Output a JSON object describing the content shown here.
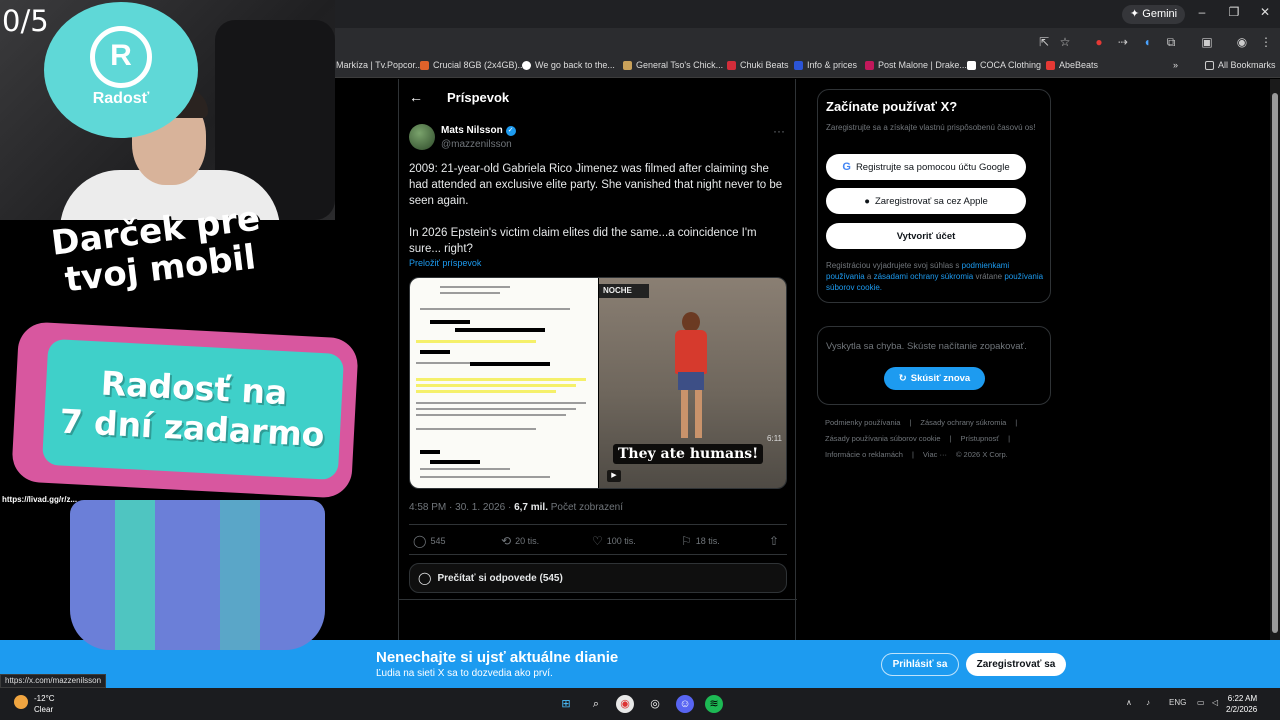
{
  "browser": {
    "gemini_label": "Gemini",
    "bookmarks": [
      {
        "label": "Markíza | Tv.Popcor...",
        "color": "#e05a2a"
      },
      {
        "label": "Crucial 8GB (2x4GB)...",
        "color": "#e0622a"
      },
      {
        "label": "We go back to the...",
        "color": "#ffffff"
      },
      {
        "label": "General Tso's Chick...",
        "color": "#c9a15a"
      },
      {
        "label": "Chuki Beats",
        "color": "#d22d3a"
      },
      {
        "label": "Info & prices",
        "color": "#2b54d6"
      },
      {
        "label": "Post Malone | Drake...",
        "color": "#c2185b"
      },
      {
        "label": "COCA Clothing",
        "color": "#ffffff"
      },
      {
        "label": "AbeBeats",
        "color": "#e53935"
      }
    ],
    "all_bookmarks": "All Bookmarks",
    "status_url": "https://x.com/mazzenilsson"
  },
  "post": {
    "header": "Príspevok",
    "author_name": "Mats Nilsson",
    "author_handle": "@mazzenilsson",
    "text_p1": "2009: 21-year-old Gabriela Rico Jimenez was filmed after claiming she had attended an exclusive elite party. She vanished that night never to be seen again.",
    "text_p2": "In 2026 Epstein's victim claim elites did the same...a coincidence I'm sure... right?",
    "translate": "Preložiť príspevok",
    "video_caption": "They ate humans!",
    "video_sign": "NOCHE",
    "video_time": "6:11",
    "timestamp": "4:58 PM · 30. 1. 2026 · ",
    "views": "6,7 mil.",
    "views_label": " Počet zobrazení",
    "replies": "545",
    "reposts": "20 tis.",
    "likes": "100 tis.",
    "bookmarks": "18 tis.",
    "read_replies": "Prečítať si odpovede (545)"
  },
  "sidebar": {
    "title": "Začínate používať X?",
    "subtitle": "Zaregistrujte sa a získajte vlastnú prispôsobenú časovú os!",
    "google_btn": "Registrujte sa pomocou účtu Google",
    "apple_btn": "Zaregistrovať sa cez Apple",
    "create_btn": "Vytvoriť účet",
    "legal_pre": "Registráciou vyjadrujete svoj súhlas s ",
    "legal_link1": "podmienkami používania",
    "legal_mid": " a ",
    "legal_link2": "zásadami ochrany súkromia",
    "legal_mid2": " vrátane ",
    "legal_link3": "používania súborov cookie.",
    "error_msg": "Vyskytla sa chyba. Skúste načítanie zopakovať.",
    "retry": "Skúsiť znova",
    "footer": [
      "Podmienky používania",
      "|",
      "Zásady ochrany súkromia",
      "|",
      "Zásady používania súborov cookie",
      "|",
      "Prístupnosť",
      "|",
      "Informácie o reklamách",
      "|",
      "Viac ···",
      "© 2026 X Corp."
    ]
  },
  "banner": {
    "title": "Nenechajte si ujsť aktuálne dianie",
    "subtitle": "Ľudia na sieti X sa to dozvedia ako prví.",
    "login": "Prihlásiť sa",
    "signup": "Zaregistrovať sa"
  },
  "taskbar": {
    "temp": "-12°C",
    "weather": "Clear",
    "lang": "ENG",
    "time": "6:22 AM",
    "date": "2/2/2026"
  },
  "overlay": {
    "counter": "0/5",
    "logo_letter": "R",
    "logo_name": "Radosť",
    "promo_line1": "Darček pre",
    "promo_line2": "tvoj mobil",
    "phone_line1": "Radosť na",
    "phone_line2": "7 dní zadarmo",
    "chat_link": "https://livad.gg/r/z..."
  },
  "colors": {
    "accent": "#1d9bf0",
    "brand_teal": "#5fd8d7",
    "phone_pink": "#d8579f"
  }
}
